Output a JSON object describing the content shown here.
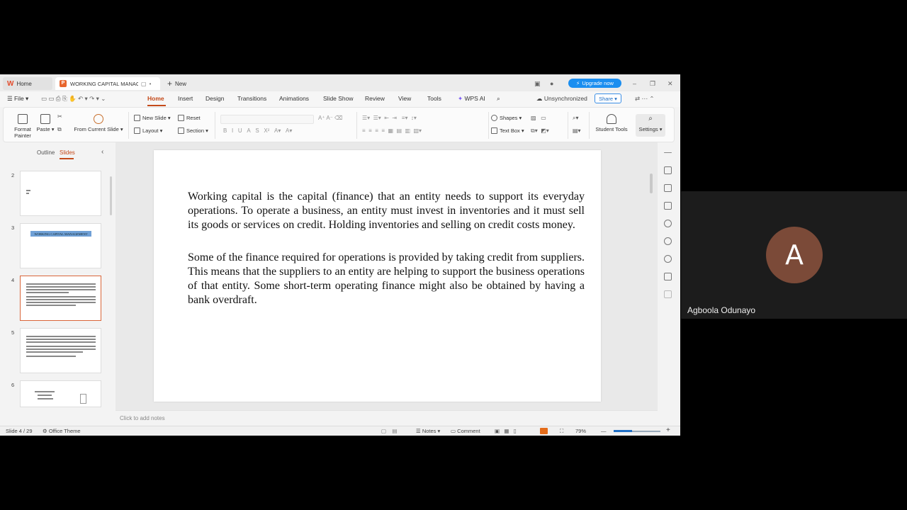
{
  "window": {
    "home_tab": "Home",
    "doc_tab": "WORKING CAPITAL MANAG",
    "new_tab": "New",
    "upgrade": "Upgrade now"
  },
  "menu": {
    "file": "File",
    "items": [
      "Home",
      "Insert",
      "Design",
      "Transitions",
      "Animations",
      "Slide Show",
      "Review",
      "View",
      "Tools",
      "WPS AI"
    ],
    "unsync": "Unsynchronized",
    "share": "Share"
  },
  "ribbon": {
    "format_painter_1": "Format",
    "format_painter_2": "Painter",
    "paste": "Paste",
    "from_current": "From Current Slide",
    "new_slide": "New Slide",
    "reset": "Reset",
    "layout": "Layout",
    "section": "Section",
    "shapes": "Shapes",
    "text_box": "Text Box",
    "student_tools": "Student Tools",
    "settings": "Settings"
  },
  "leftpanel": {
    "outline": "Outline",
    "slides": "Slides",
    "thumbs": [
      {
        "num": "2"
      },
      {
        "num": "3",
        "banner": "WORKING CAPITAL MANAGEMENT"
      },
      {
        "num": "4"
      },
      {
        "num": "5"
      },
      {
        "num": "6"
      }
    ]
  },
  "slide": {
    "para1": "Working capital is the capital (finance) that an entity needs to support its everyday operations. To operate a business, an entity must invest in inventories  and it must sell its goods or services on credit. Holding inventories and selling on credit costs money.",
    "para2": "Some of the finance required for operations is provided by taking credit from suppliers. This means that the suppliers to an entity are helping to support the  business operations of that entity. Some short-term operating finance might also be obtained by having a bank overdraft."
  },
  "notes": {
    "placeholder": "Click to add notes"
  },
  "status": {
    "slide_of": "Slide 4 / 29",
    "theme": "Office Theme",
    "notes": "Notes",
    "comment": "Comment",
    "zoom": "79%"
  },
  "participant": {
    "initial": "A",
    "name": "Agboola Odunayo"
  }
}
